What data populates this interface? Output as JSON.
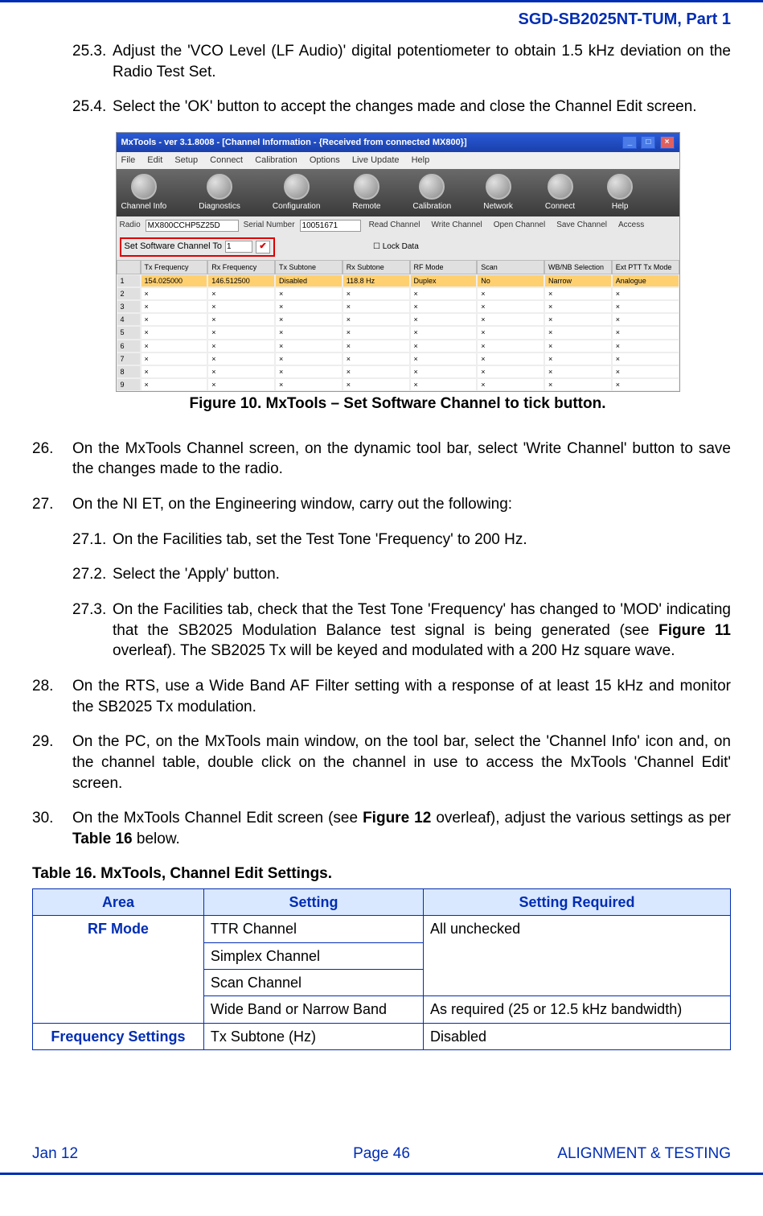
{
  "header": {
    "doc_id": "SGD-SB2025NT-TUM, Part 1"
  },
  "sub_items_top": [
    {
      "num": "25.3.",
      "text": "Adjust the 'VCO Level (LF Audio)' digital potentiometer to obtain 1.5 kHz deviation on the Radio Test Set."
    },
    {
      "num": "25.4.",
      "text": "Select the 'OK' button to accept the changes made and close the Channel Edit screen."
    }
  ],
  "figure10_caption": "Figure 10.  MxTools – Set Software Channel to tick button.",
  "screenshot": {
    "title": "MxTools - ver  3.1.8008  - [Channel Information  - {Received from connected MX800}]",
    "menu": [
      "File",
      "Edit",
      "Setup",
      "Connect",
      "Calibration",
      "Options",
      "Live Update",
      "Help"
    ],
    "icons": [
      "Channel Info",
      "Diagnostics",
      "Configuration",
      "Remote",
      "Calibration",
      "Network",
      "Connect",
      "Help"
    ],
    "radio_label": "Radio",
    "radio_value": "MX800CCHP5Z25D",
    "serial_label": "Serial Number",
    "serial_value": "10051671",
    "buttons": [
      "Read Channel",
      "Write Channel",
      "Open Channel",
      "Save Channel",
      "Access"
    ],
    "set_sw_label": "Set Software Channel To",
    "set_sw_value": "1",
    "lock_data": "Lock Data",
    "grid_headers": [
      "",
      "Tx Frequency",
      "Rx Frequency",
      "Tx Subtone",
      "Rx Subtone",
      "RF Mode",
      "Scan",
      "WB/NB Selection",
      "Ext PTT Tx Mode"
    ],
    "grid_row1": [
      "1",
      "154.025000",
      "146.512500",
      "Disabled",
      "118.8 Hz",
      "Duplex",
      "No",
      "Narrow",
      "Analogue"
    ],
    "grid_x_rows": [
      "2",
      "3",
      "4",
      "5",
      "6",
      "7",
      "8",
      "9"
    ]
  },
  "items": [
    {
      "num": "26.",
      "text": "On the MxTools Channel screen, on the dynamic tool bar, select 'Write Channel' button to save the changes made to the radio."
    },
    {
      "num": "27.",
      "text": "On the NI ET, on the Engineering window, carry out the following:"
    }
  ],
  "sub_items_27": [
    {
      "num": "27.1.",
      "text": "On the Facilities tab, set the Test Tone 'Frequency' to 200 Hz."
    },
    {
      "num": "27.2.",
      "text": "Select the 'Apply' button."
    },
    {
      "num": "27.3.",
      "pre": "On  the  Facilities  tab,  check  that  the  Test  Tone  'Frequency'  has  changed  to  'MOD' indicating  that  the  SB2025  Modulation  Balance  test  signal  is  being  generated  (see ",
      "bold": "Figure 11",
      "post": " overleaf).   The  SB2025  Tx  will  be  keyed  and  modulated  with  a  200  Hz square wave."
    }
  ],
  "items2": [
    {
      "num": "28.",
      "text": "On  the  RTS,  use  a  Wide  Band  AF  Filter  setting  with  a  response  of  at  least  15  kHz  and monitor the SB2025 Tx modulation."
    },
    {
      "num": "29.",
      "text": "On the PC, on the MxTools main window, on the tool bar, select the 'Channel Info' icon and, on the channel table, double click on the channel in use to access the MxTools 'Channel Edit' screen."
    }
  ],
  "item30": {
    "num": "30.",
    "pre": "On the MxTools Channel Edit screen (see ",
    "bold1": "Figure 12",
    "mid": " overleaf), adjust the various settings as per ",
    "bold2": "Table 16",
    "post": " below."
  },
  "table16": {
    "title": "Table 16.  MxTools, Channel Edit Settings.",
    "headers": [
      "Area",
      "Setting",
      "Setting Required"
    ],
    "rf_mode_label": "RF Mode",
    "rf_rows": [
      "TTR Channel",
      "Simplex Channel",
      "Scan Channel"
    ],
    "rf_required": "All unchecked",
    "wb_row": {
      "setting": "Wide Band or Narrow Band",
      "required": "As required (25 or 12.5 kHz bandwidth)"
    },
    "freq_label": "Frequency Settings",
    "freq_row": {
      "setting": "Tx Subtone (Hz)",
      "required": "Disabled"
    }
  },
  "footer": {
    "left": "Jan 12",
    "center": "Page 46",
    "right": "ALIGNMENT & TESTING"
  }
}
